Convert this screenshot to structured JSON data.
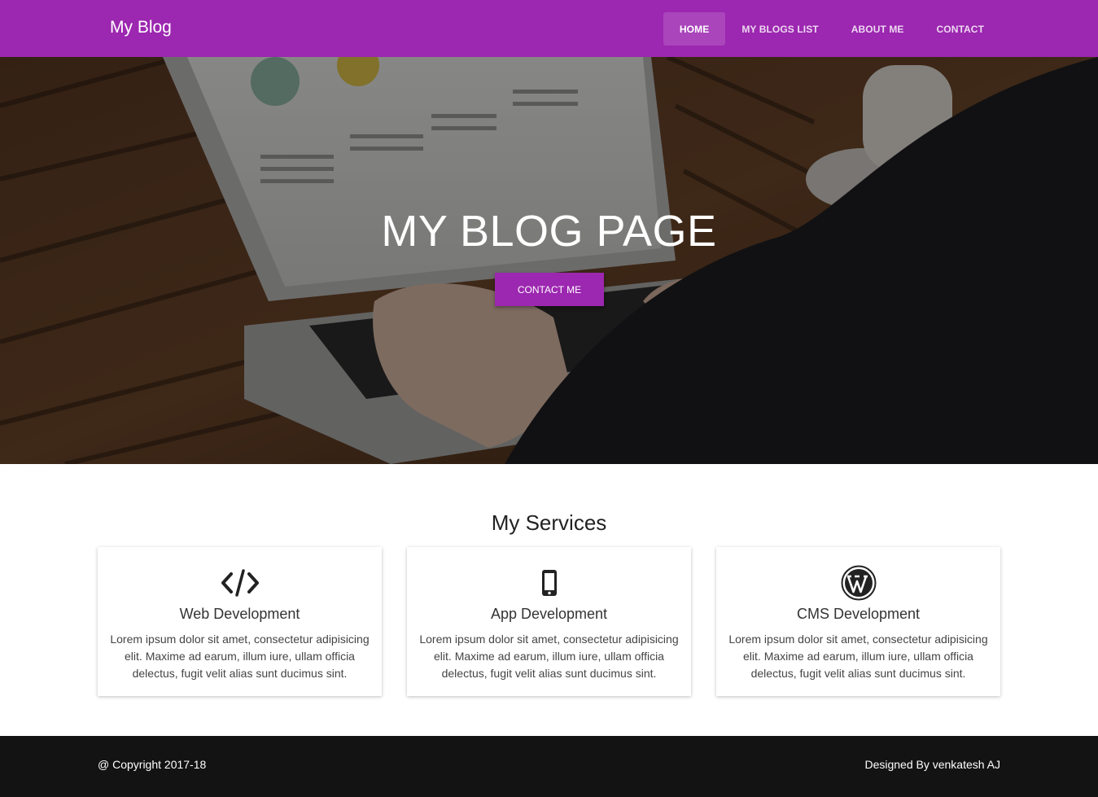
{
  "navbar": {
    "brand": "My Blog",
    "links": [
      {
        "label": "HOME",
        "active": true
      },
      {
        "label": "MY BLOGS LIST",
        "active": false
      },
      {
        "label": "ABOUT ME",
        "active": false
      },
      {
        "label": "CONTACT",
        "active": false
      }
    ]
  },
  "hero": {
    "title": "MY BLOG PAGE",
    "button_label": "CONTACT ME"
  },
  "services": {
    "title": "My Services",
    "cards": [
      {
        "icon": "code-icon",
        "title": "Web Development",
        "text": "Lorem ipsum dolor sit amet, consectetur adipisicing elit. Maxime ad earum, illum iure, ullam officia delectus, fugit velit alias sunt ducimus sint."
      },
      {
        "icon": "mobile-phone-icon",
        "title": "App Development",
        "text": "Lorem ipsum dolor sit amet, consectetur adipisicing elit. Maxime ad earum, illum iure, ullam officia delectus, fugit velit alias sunt ducimus sint."
      },
      {
        "icon": "wordpress-icon",
        "title": "CMS Development",
        "text": "Lorem ipsum dolor sit amet, consectetur adipisicing elit. Maxime ad earum, illum iure, ullam officia delectus, fugit velit alias sunt ducimus sint."
      }
    ]
  },
  "footer": {
    "copyright": "@ Copyright 2017-18",
    "credit": "Designed By venkatesh AJ"
  },
  "colors": {
    "primary": "#9c27b0",
    "footer": "#131313"
  }
}
